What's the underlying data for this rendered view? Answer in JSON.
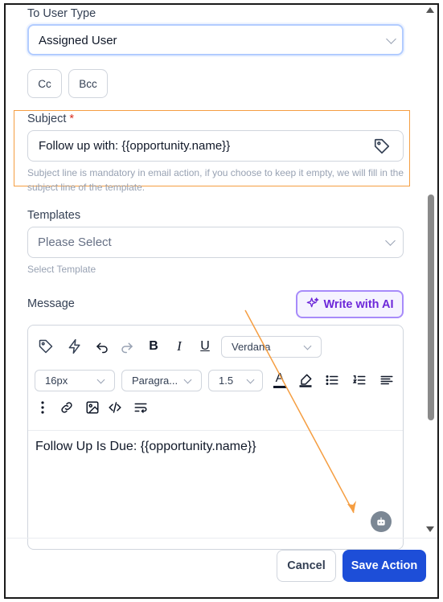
{
  "to_user_type": {
    "label": "To User Type",
    "value": "Assigned User"
  },
  "recipients": {
    "cc_label": "Cc",
    "bcc_label": "Bcc"
  },
  "subject": {
    "label": "Subject",
    "required_mark": "*",
    "value": "Follow up with: {{opportunity.name}}",
    "hint": "Subject line is mandatory in email action, if you choose to keep it empty, we will fill in the subject line of the template."
  },
  "templates": {
    "label": "Templates",
    "placeholder": "Please Select",
    "hint": "Select Template"
  },
  "message": {
    "label": "Message",
    "ai_button": "Write with AI",
    "toolbar": {
      "font_family": "Verdana",
      "font_size": "16px",
      "block_format": "Paragra...",
      "line_height": "1.5",
      "bold": "B",
      "italic": "I",
      "underline": "U",
      "text_color": "A"
    },
    "body": "Follow Up Is Due: {{opportunity.name}}"
  },
  "footer": {
    "cancel_label": "Cancel",
    "save_label": "Save Action"
  },
  "colors": {
    "accent": "#1d4ed8",
    "ai_purple": "#6d28d9",
    "highlight_orange": "#f59e42",
    "required_red": "#d92d20"
  }
}
